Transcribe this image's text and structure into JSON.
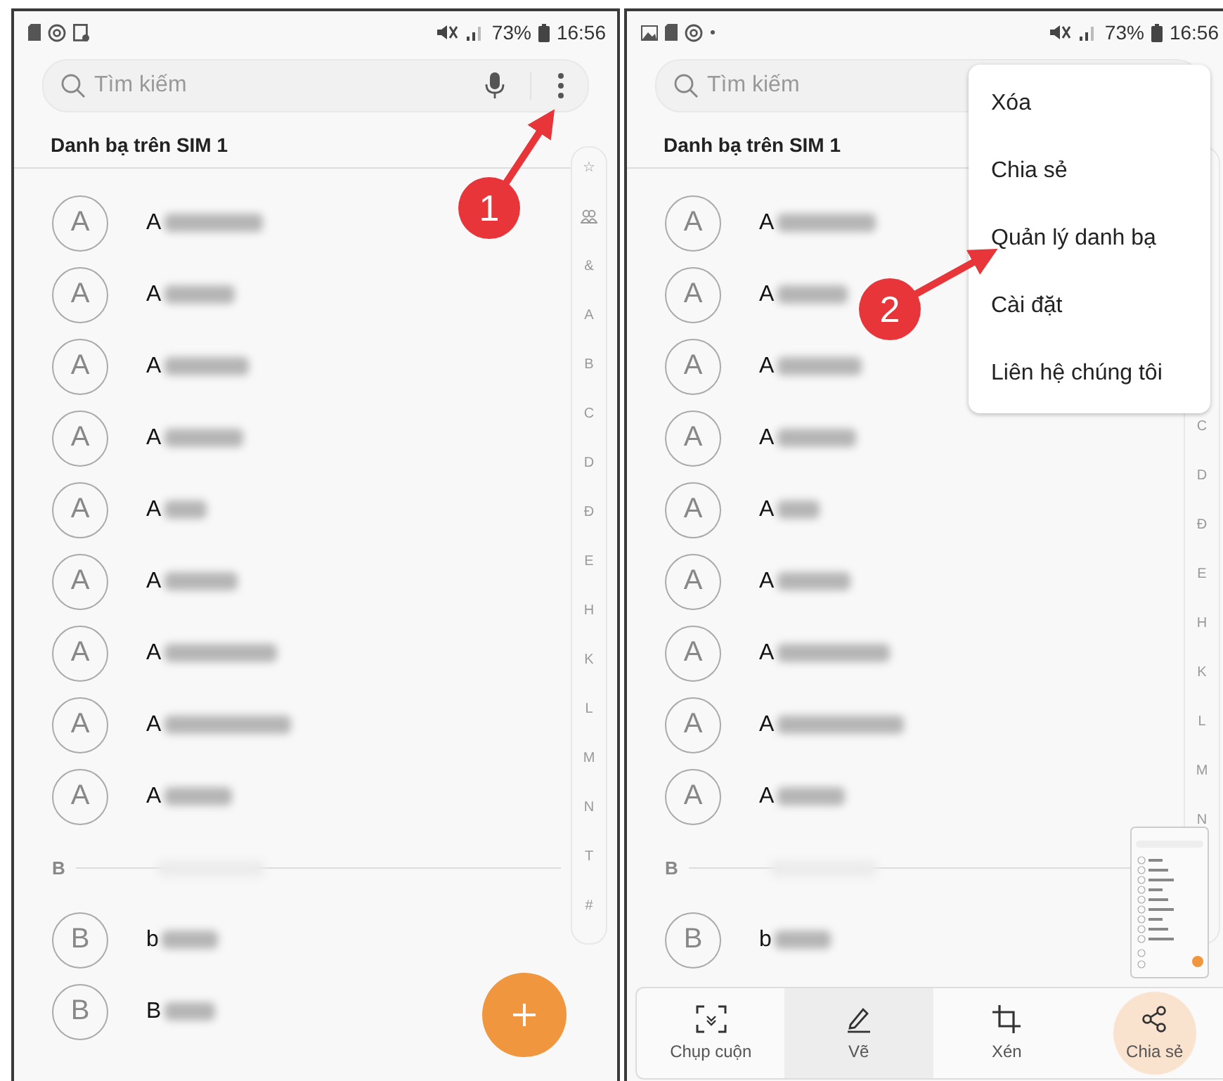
{
  "screens": [
    {
      "status_bar": {
        "battery": "73%",
        "time": "16:56"
      },
      "search": {
        "placeholder": "Tìm kiếm"
      },
      "section_title": "Danh bạ trên SIM 1",
      "rows": [
        {
          "kind": "contact",
          "initial": "A",
          "name": "A"
        },
        {
          "kind": "contact",
          "initial": "A",
          "name": "A"
        },
        {
          "kind": "contact",
          "initial": "A",
          "name": "A"
        },
        {
          "kind": "contact",
          "initial": "A",
          "name": "A"
        },
        {
          "kind": "contact",
          "initial": "A",
          "name": "A"
        },
        {
          "kind": "contact",
          "initial": "A",
          "name": "A"
        },
        {
          "kind": "contact",
          "initial": "A",
          "name": "A"
        },
        {
          "kind": "contact",
          "initial": "A",
          "name": "A"
        },
        {
          "kind": "contact",
          "initial": "A",
          "name": "A"
        },
        {
          "kind": "header",
          "letter": "B"
        },
        {
          "kind": "contact",
          "initial": "B",
          "name": "b"
        },
        {
          "kind": "contact",
          "initial": "B",
          "name": "B"
        }
      ],
      "index": [
        {
          "kind": "letter",
          "label": "☆"
        },
        {
          "kind": "icon"
        },
        {
          "kind": "letter",
          "label": "&"
        },
        {
          "kind": "letter",
          "label": "A"
        },
        {
          "kind": "letter",
          "label": "B"
        },
        {
          "kind": "letter",
          "label": "C"
        },
        {
          "kind": "letter",
          "label": "D"
        },
        {
          "kind": "letter",
          "label": "Đ"
        },
        {
          "kind": "letter",
          "label": "E"
        },
        {
          "kind": "letter",
          "label": "H"
        },
        {
          "kind": "letter",
          "label": "K"
        },
        {
          "kind": "letter",
          "label": "L"
        },
        {
          "kind": "letter",
          "label": "M"
        },
        {
          "kind": "letter",
          "label": "N"
        },
        {
          "kind": "letter",
          "label": "T"
        },
        {
          "kind": "letter",
          "label": "#"
        }
      ]
    },
    {
      "status_bar": {
        "battery": "73%",
        "time": "16:56"
      },
      "search": {
        "placeholder": "Tìm kiếm"
      },
      "section_title": "Danh bạ trên SIM 1",
      "rows": [
        {
          "kind": "contact",
          "initial": "A",
          "name": "A"
        },
        {
          "kind": "contact",
          "initial": "A",
          "name": "A"
        },
        {
          "kind": "contact",
          "initial": "A",
          "name": "A"
        },
        {
          "kind": "contact",
          "initial": "A",
          "name": "A"
        },
        {
          "kind": "contact",
          "initial": "A",
          "name": "A"
        },
        {
          "kind": "contact",
          "initial": "A",
          "name": "A"
        },
        {
          "kind": "contact",
          "initial": "A",
          "name": "A"
        },
        {
          "kind": "contact",
          "initial": "A",
          "name": "A"
        },
        {
          "kind": "contact",
          "initial": "A",
          "name": "A"
        },
        {
          "kind": "header",
          "letter": "B"
        },
        {
          "kind": "contact",
          "initial": "B",
          "name": "b"
        }
      ],
      "index": [
        {
          "kind": "letter",
          "label": "C"
        },
        {
          "kind": "letter",
          "label": "D"
        },
        {
          "kind": "letter",
          "label": "Đ"
        },
        {
          "kind": "letter",
          "label": "E"
        },
        {
          "kind": "letter",
          "label": "H"
        },
        {
          "kind": "letter",
          "label": "K"
        },
        {
          "kind": "letter",
          "label": "L"
        },
        {
          "kind": "letter",
          "label": "M"
        },
        {
          "kind": "letter",
          "label": "N"
        }
      ],
      "menu": {
        "items": [
          {
            "label": "Xóa"
          },
          {
            "label": "Chia sẻ"
          },
          {
            "label": "Quản lý danh bạ"
          },
          {
            "label": "Cài đặt"
          },
          {
            "label": "Liên hệ chúng tôi"
          }
        ]
      },
      "preview": {
        "kind": "screenshot"
      },
      "toolbar": {
        "items": [
          {
            "kind": "scroll-capture",
            "label": "Chụp cuộn",
            "selected": false
          },
          {
            "kind": "draw",
            "label": "Vẽ",
            "selected": true
          },
          {
            "kind": "crop",
            "label": "Xén",
            "selected": false
          },
          {
            "kind": "share",
            "label": "Chia sẻ",
            "selected": false
          }
        ]
      }
    }
  ],
  "annotations": [
    {
      "label": "1"
    },
    {
      "label": "2"
    }
  ]
}
